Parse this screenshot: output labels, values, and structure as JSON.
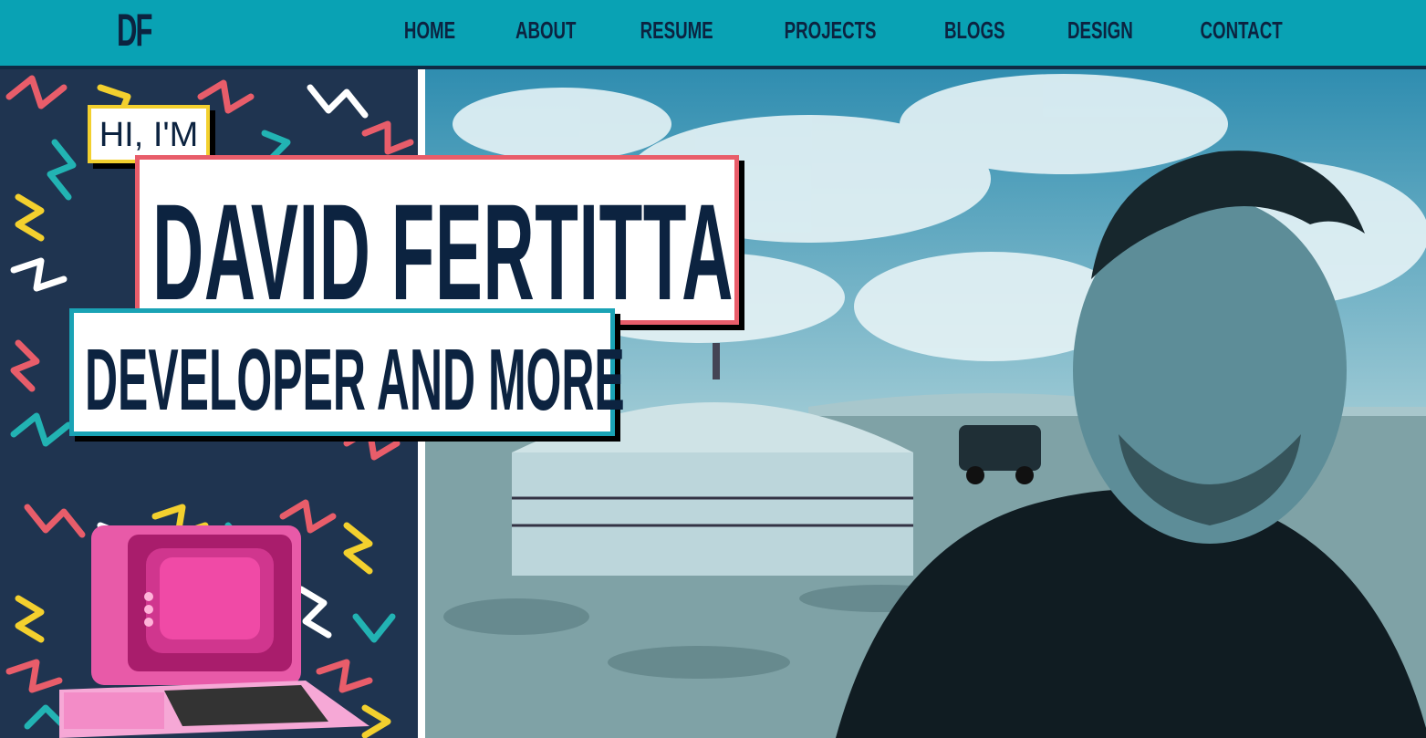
{
  "nav": {
    "logo": "DF",
    "links": [
      "HOME",
      "ABOUT",
      "RESUME",
      "PROJECTS",
      "BLOGS",
      "DESIGN",
      "CONTACT"
    ]
  },
  "hero": {
    "greeting": "HI, I'M",
    "name": "DAVID FERTITTA",
    "tagline": "DEVELOPER AND MORE"
  },
  "colors": {
    "nav_bg": "#09a2b4",
    "navy": "#0c2340",
    "yellow": "#f3d02e",
    "coral": "#e85d6a",
    "teal": "#1aa3b5"
  },
  "icons": [
    "retro-computer-icon"
  ]
}
